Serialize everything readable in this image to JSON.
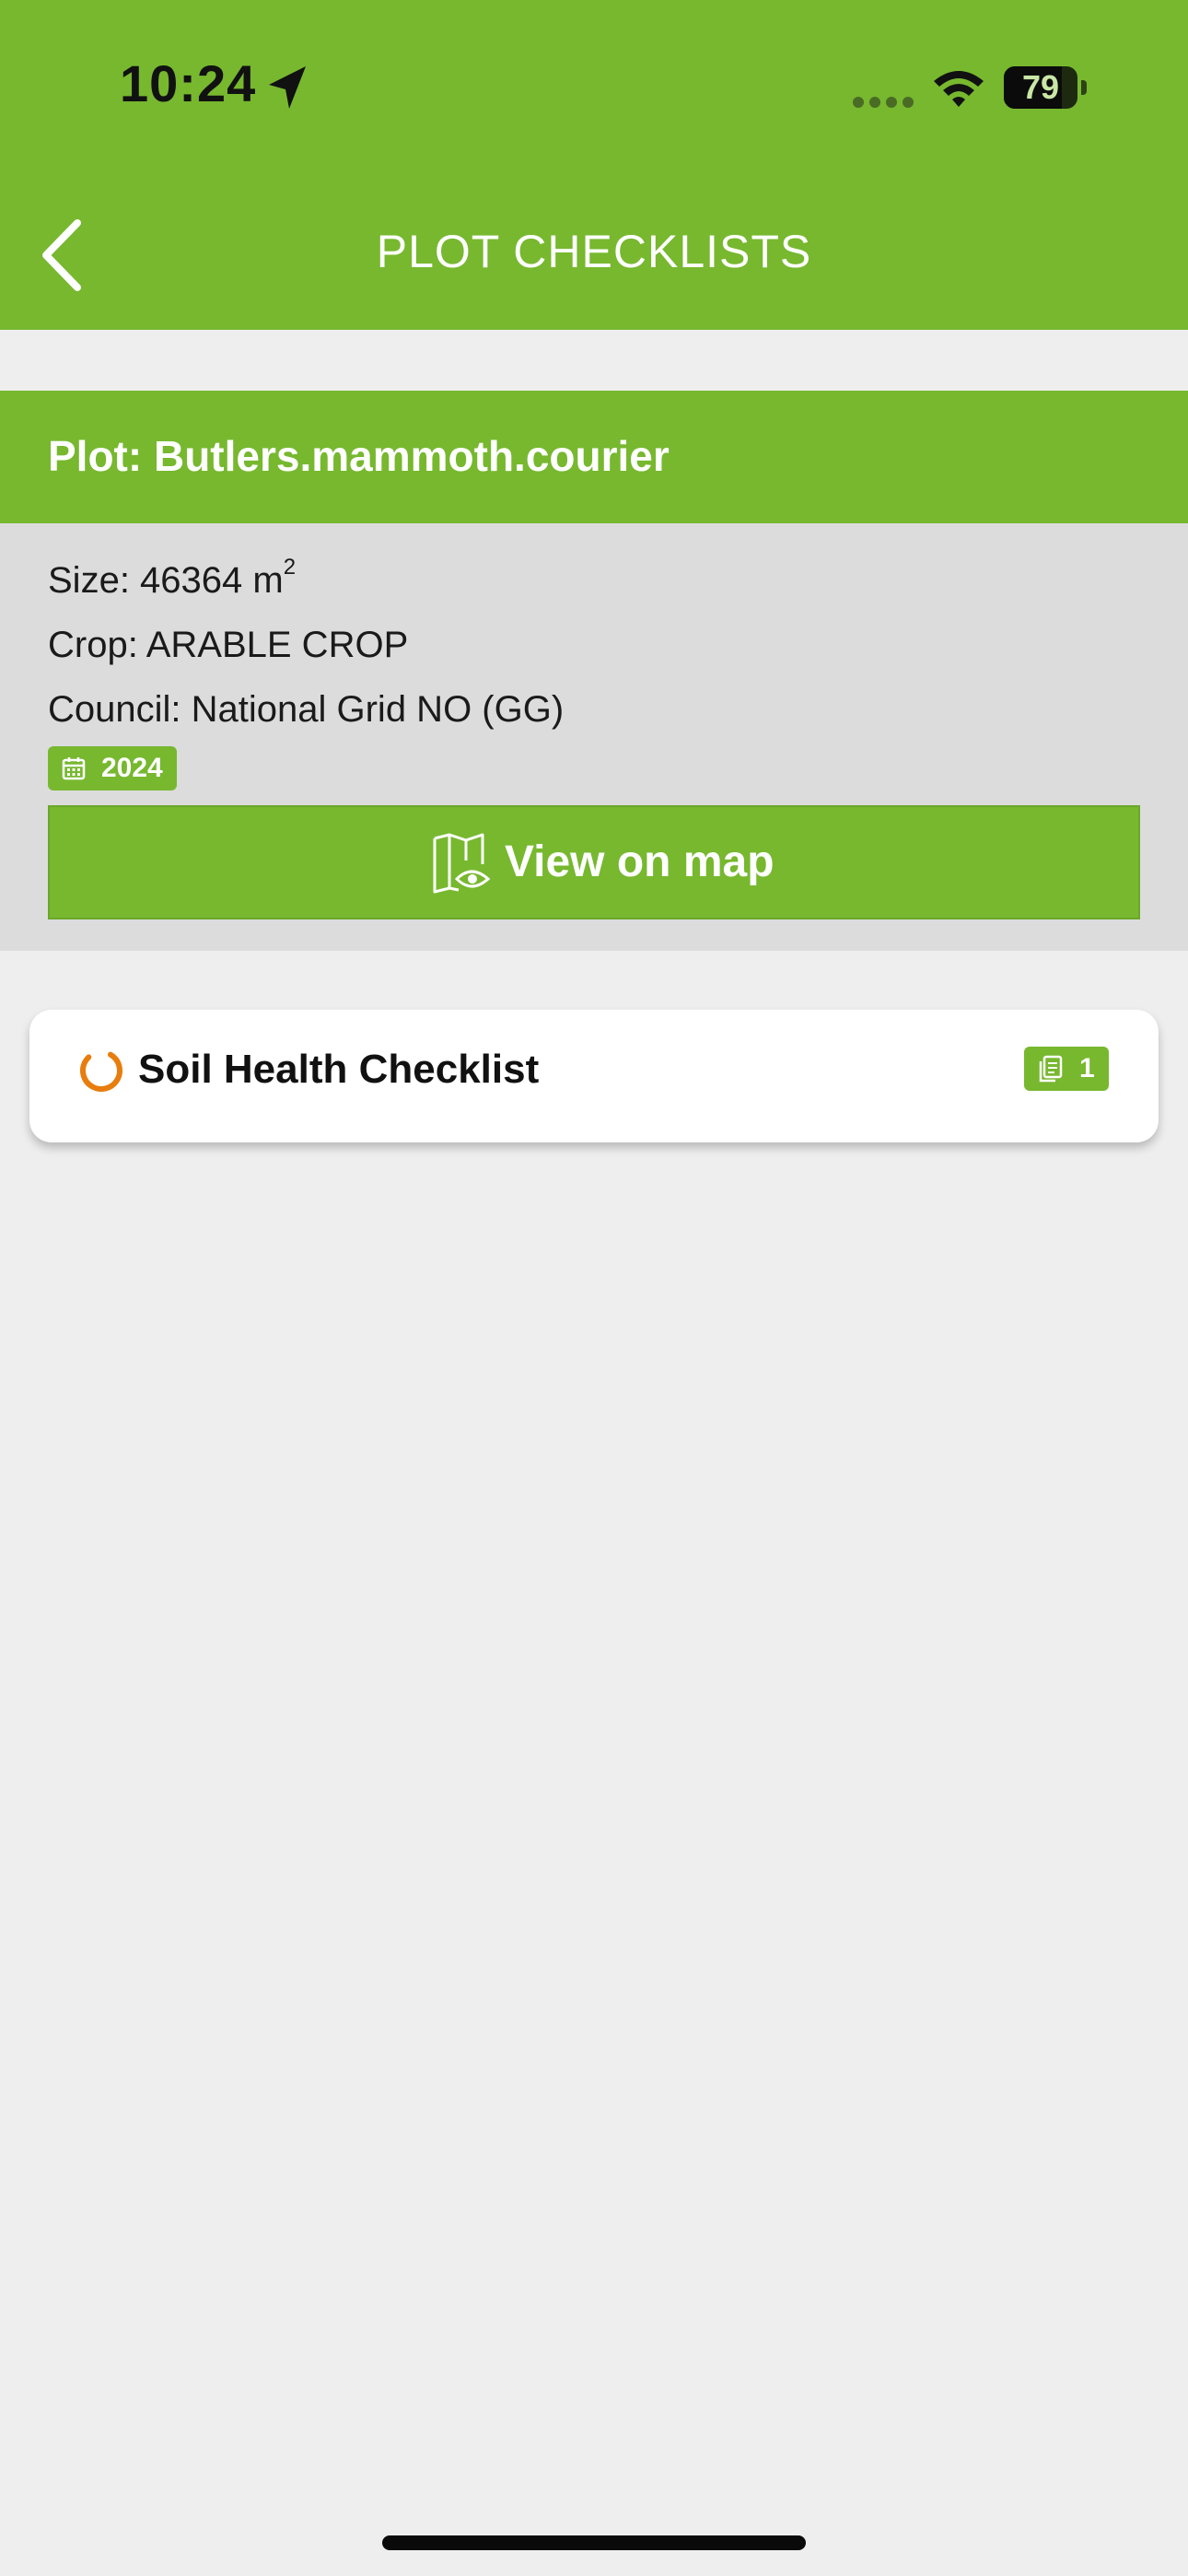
{
  "status_bar": {
    "time": "10:24",
    "battery": "79",
    "battery_level": 0.79,
    "location_icon": "location-arrow-icon",
    "signal_icon": "cellular-signal-icon",
    "wifi_icon": "wifi-icon"
  },
  "header": {
    "title": "PLOT CHECKLISTS",
    "back_icon": "chevron-left-icon"
  },
  "plot": {
    "name": "Plot: Butlers.mammoth.courier",
    "size_label": "Size: 46364 m",
    "size_unit_sup": "2",
    "crop": "Crop: ARABLE CROP",
    "council": "Council: National Grid NO (GG)",
    "year": "2024",
    "year_icon": "calendar-icon",
    "map_button_label": "View on map",
    "map_icon": "map-view-icon"
  },
  "checklists": [
    {
      "title": "Soil Health Checklist",
      "status_icon": "in-progress-icon",
      "count": "1",
      "count_icon": "documents-icon"
    }
  ],
  "colors": {
    "primary": "#77b82f",
    "background": "#eeeeee",
    "details_background": "#dcdcdc",
    "progress": "#e87d0d"
  }
}
